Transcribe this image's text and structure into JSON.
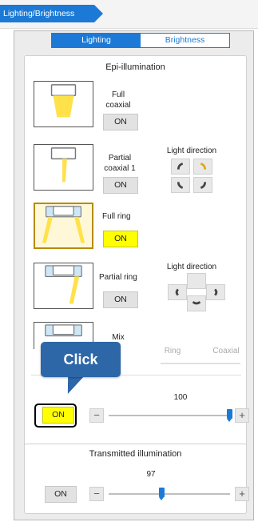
{
  "title_tab": "Lighting/Brightness",
  "mode_tabs": [
    {
      "label": "Lighting",
      "active": true
    },
    {
      "label": "Brightness",
      "active": false
    }
  ],
  "epi": {
    "title": "Epi-illumination",
    "full_coaxial": {
      "label": "Full coaxial",
      "button": "ON",
      "on": false
    },
    "partial_coaxial": {
      "label": "Partial coaxial 1",
      "button": "ON",
      "on": false,
      "dir_label": "Light direction"
    },
    "full_ring": {
      "label": "Full ring",
      "button": "ON",
      "on": true
    },
    "partial_ring": {
      "label": "Partial ring",
      "button": "ON",
      "on": false,
      "dir_label": "Light direction"
    },
    "mix": {
      "label": "Mix",
      "left": "Ring",
      "right": "Coaxial"
    },
    "intensity": {
      "button": "ON",
      "on": true,
      "value": "100",
      "fraction": 1.0
    }
  },
  "callout": {
    "text": "Click"
  },
  "transmitted": {
    "title": "Transmitted illumination",
    "button": "ON",
    "on": false,
    "value": "97",
    "fraction": 0.5
  },
  "colors": {
    "accent": "#1c7ad6",
    "on": "#ffff00",
    "callout": "#2d67a8"
  },
  "icons": {
    "minus": "minus-icon",
    "plus": "plus-icon"
  }
}
